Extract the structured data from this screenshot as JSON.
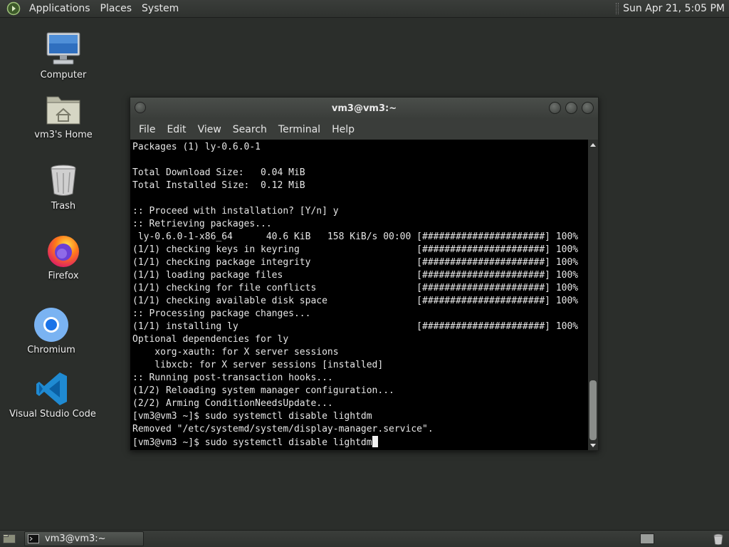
{
  "top_panel": {
    "menus": [
      "Applications",
      "Places",
      "System"
    ],
    "clock": "Sun Apr 21,  5:05 PM"
  },
  "desktop_icons": [
    {
      "label": "Computer",
      "icon": "computer-icon"
    },
    {
      "label": "vm3's Home",
      "icon": "home-folder-icon"
    },
    {
      "label": "Trash",
      "icon": "trash-icon"
    },
    {
      "label": "Firefox",
      "icon": "firefox-icon"
    },
    {
      "label": "Chromium",
      "icon": "chromium-icon"
    },
    {
      "label": "Visual Studio Code",
      "icon": "vscode-icon"
    }
  ],
  "terminal": {
    "title": "vm3@vm3:~",
    "menu": [
      "File",
      "Edit",
      "View",
      "Search",
      "Terminal",
      "Help"
    ],
    "lines": [
      "Packages (1) ly-0.6.0-1",
      "",
      "Total Download Size:   0.04 MiB",
      "Total Installed Size:  0.12 MiB",
      "",
      ":: Proceed with installation? [Y/n] y",
      ":: Retrieving packages...",
      " ly-0.6.0-1-x86_64      40.6 KiB   158 KiB/s 00:00 [######################] 100%",
      "(1/1) checking keys in keyring                     [######################] 100%",
      "(1/1) checking package integrity                   [######################] 100%",
      "(1/1) loading package files                        [######################] 100%",
      "(1/1) checking for file conflicts                  [######################] 100%",
      "(1/1) checking available disk space                [######################] 100%",
      ":: Processing package changes...",
      "(1/1) installing ly                                [######################] 100%",
      "Optional dependencies for ly",
      "    xorg-xauth: for X server sessions",
      "    libxcb: for X server sessions [installed]",
      ":: Running post-transaction hooks...",
      "(1/2) Reloading system manager configuration...",
      "(2/2) Arming ConditionNeedsUpdate...",
      "[vm3@vm3 ~]$ sudo systemctl disable lightdm",
      "Removed \"/etc/systemd/system/display-manager.service\"."
    ],
    "prompt_line": "[vm3@vm3 ~]$ sudo systemctl disable lightdm"
  },
  "taskbar": {
    "task_label": "vm3@vm3:~"
  }
}
